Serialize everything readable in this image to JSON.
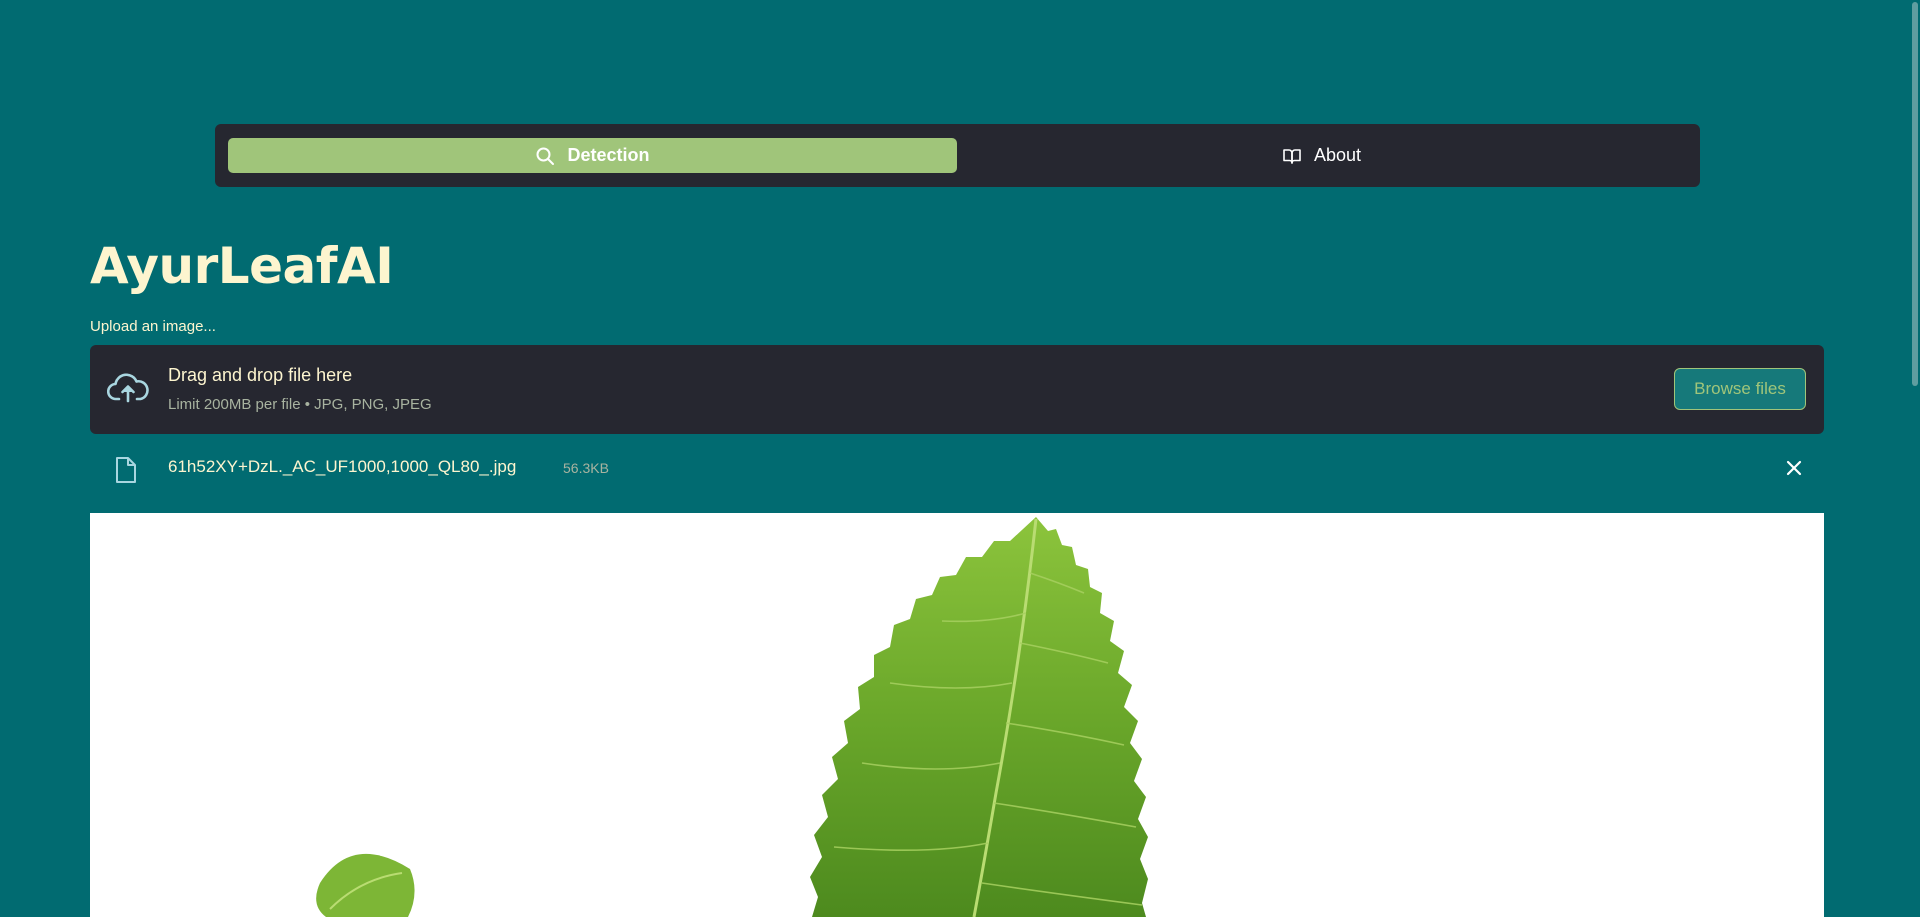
{
  "nav": {
    "tabs": [
      {
        "label": "Detection",
        "icon": "search-icon",
        "active": true
      },
      {
        "label": "About",
        "icon": "book-icon",
        "active": false
      }
    ]
  },
  "app": {
    "title": "AyurLeafAI"
  },
  "uploader": {
    "label": "Upload an image...",
    "dropzone_title": "Drag and drop file here",
    "dropzone_limit": "Limit 200MB per file • JPG, PNG, JPEG",
    "browse_label": "Browse files",
    "icon": "cloud-upload-icon"
  },
  "uploaded_file": {
    "name": "61h52XY+DzL._AC_UF1000,1000_QL80_.jpg",
    "size": "56.3KB",
    "icon": "file-icon",
    "remove_icon": "close-icon"
  },
  "colors": {
    "background": "#016b71",
    "panel": "#262730",
    "accent": "#a0c57a",
    "title_text": "#fdf5cf"
  }
}
